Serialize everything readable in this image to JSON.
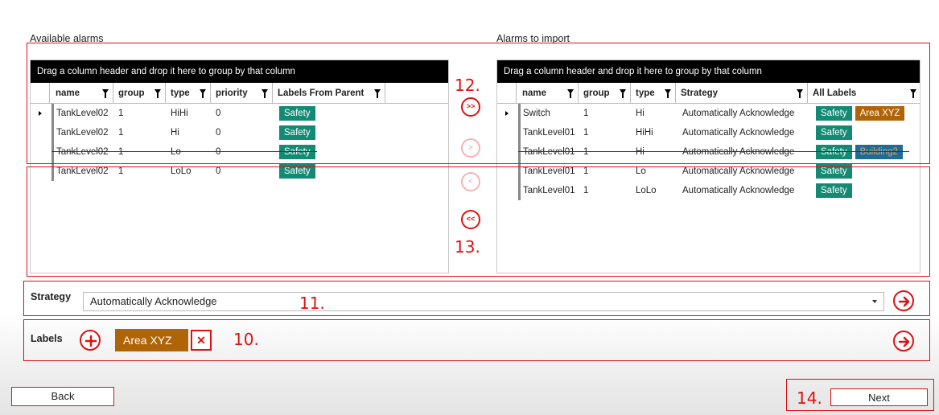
{
  "available": {
    "title": "Available alarms",
    "group_hint": "Drag a column header and drop it here to group by that column",
    "columns": [
      "name",
      "group",
      "type",
      "priority",
      "Labels From Parent"
    ],
    "rows": [
      {
        "name": "TankLevel02",
        "group": "1",
        "type": "HiHi",
        "priority": "0",
        "labels": [
          "Safety"
        ],
        "current": true
      },
      {
        "name": "TankLevel02",
        "group": "1",
        "type": "Hi",
        "priority": "0",
        "labels": [
          "Safety"
        ]
      },
      {
        "name": "TankLevel02",
        "group": "1",
        "type": "Lo",
        "priority": "0",
        "labels": [
          "Safety"
        ],
        "struck": true
      },
      {
        "name": "TankLevel02",
        "group": "1",
        "type": "LoLo",
        "priority": "0",
        "labels": [
          "Safety"
        ]
      }
    ]
  },
  "import": {
    "title": "Alarms to import",
    "group_hint": "Drag a column header and drop it here to group by that column",
    "columns": [
      "name",
      "group",
      "type",
      "Strategy",
      "All Labels"
    ],
    "rows": [
      {
        "name": "Switch",
        "group": "1",
        "type": "Hi",
        "strategy": "Automatically Acknowledge",
        "labels": [
          "Safety",
          "Area XYZ"
        ],
        "current": true
      },
      {
        "name": "TankLevel01",
        "group": "1",
        "type": "HiHi",
        "strategy": "Automatically Acknowledge",
        "labels": [
          "Safety"
        ]
      },
      {
        "name": "TankLevel01",
        "group": "1",
        "type": "Hi",
        "strategy": "Automatically Acknowledge",
        "labels": [
          "Safety",
          "Building2"
        ],
        "struck": true
      },
      {
        "name": "TankLevel01",
        "group": "1",
        "type": "Lo",
        "strategy": "Automatically Acknowledge",
        "labels": [
          "Safety"
        ]
      },
      {
        "name": "TankLevel01",
        "group": "1",
        "type": "LoLo",
        "strategy": "Automatically Acknowledge",
        "labels": [
          "Safety"
        ]
      }
    ]
  },
  "transfer": {
    "add_all": ">>",
    "add_one": ">",
    "remove_one": "<",
    "remove_all": "<<"
  },
  "strategy": {
    "label": "Strategy",
    "value": "Automatically Acknowledge"
  },
  "labels": {
    "label": "Labels",
    "chip": "Area XYZ",
    "remove_glyph": "✕"
  },
  "callouts": {
    "c10": "10.",
    "c11": "11.",
    "c12": "12.",
    "c13": "13.",
    "c14": "14."
  },
  "footer": {
    "back": "Back",
    "next": "Next"
  },
  "colors": {
    "safety": "#138a73",
    "area": "#b06408",
    "building": "#1c6d96",
    "accent_red": "#e01010"
  },
  "icons": {
    "filter": "filter-icon",
    "go": "arrow-right-circle-icon",
    "add": "plus-circle-icon"
  }
}
